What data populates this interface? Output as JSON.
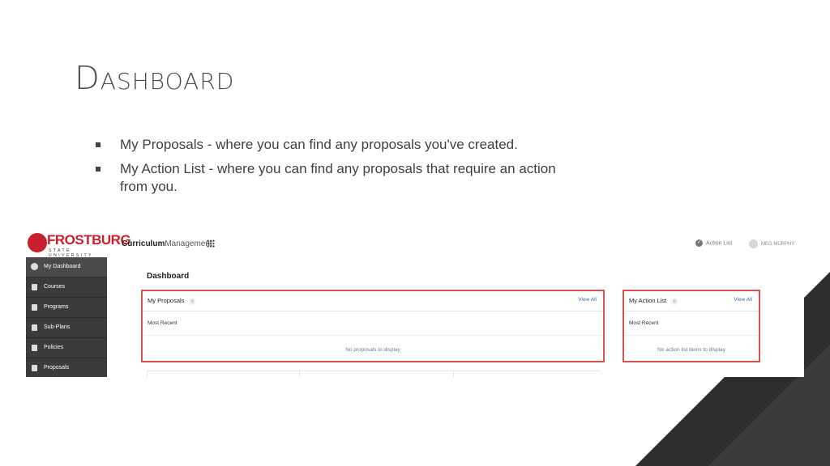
{
  "slide": {
    "title": "Dashboard",
    "bullets": [
      "My Proposals - where you can find any proposals you've created.",
      "My Action List - where you can find any proposals that require an action from you."
    ]
  },
  "app": {
    "logo": {
      "word": "FROSTBURG",
      "sub": "STATE UNIVERSITY"
    },
    "title_bold": "Curriculum",
    "title_rest": "Management",
    "action_list_label": "Action List",
    "user_name": "MEG MURPHY"
  },
  "sidebar": {
    "items": [
      {
        "label": "My Dashboard",
        "icon": "dashboard-icon"
      },
      {
        "label": "Courses",
        "icon": "courses-icon"
      },
      {
        "label": "Programs",
        "icon": "programs-icon"
      },
      {
        "label": "Sub-Plans",
        "icon": "sub-plans-icon"
      },
      {
        "label": "Policies",
        "icon": "policies-icon"
      },
      {
        "label": "Proposals",
        "icon": "proposals-icon"
      }
    ]
  },
  "dashboard": {
    "title": "Dashboard",
    "panels": [
      {
        "name": "My Proposals",
        "count": "0",
        "view_all": "View All",
        "section": "Most Recent",
        "empty": "No proposals to display"
      },
      {
        "name": "My Action List",
        "count": "0",
        "view_all": "View All",
        "section": "Most Recent",
        "empty": "No action list items to display"
      }
    ]
  },
  "colors": {
    "brand": "#c8202f",
    "highlight": "#d9534f",
    "sidebar": "#3b3b3b",
    "link": "#3a6fb0"
  }
}
